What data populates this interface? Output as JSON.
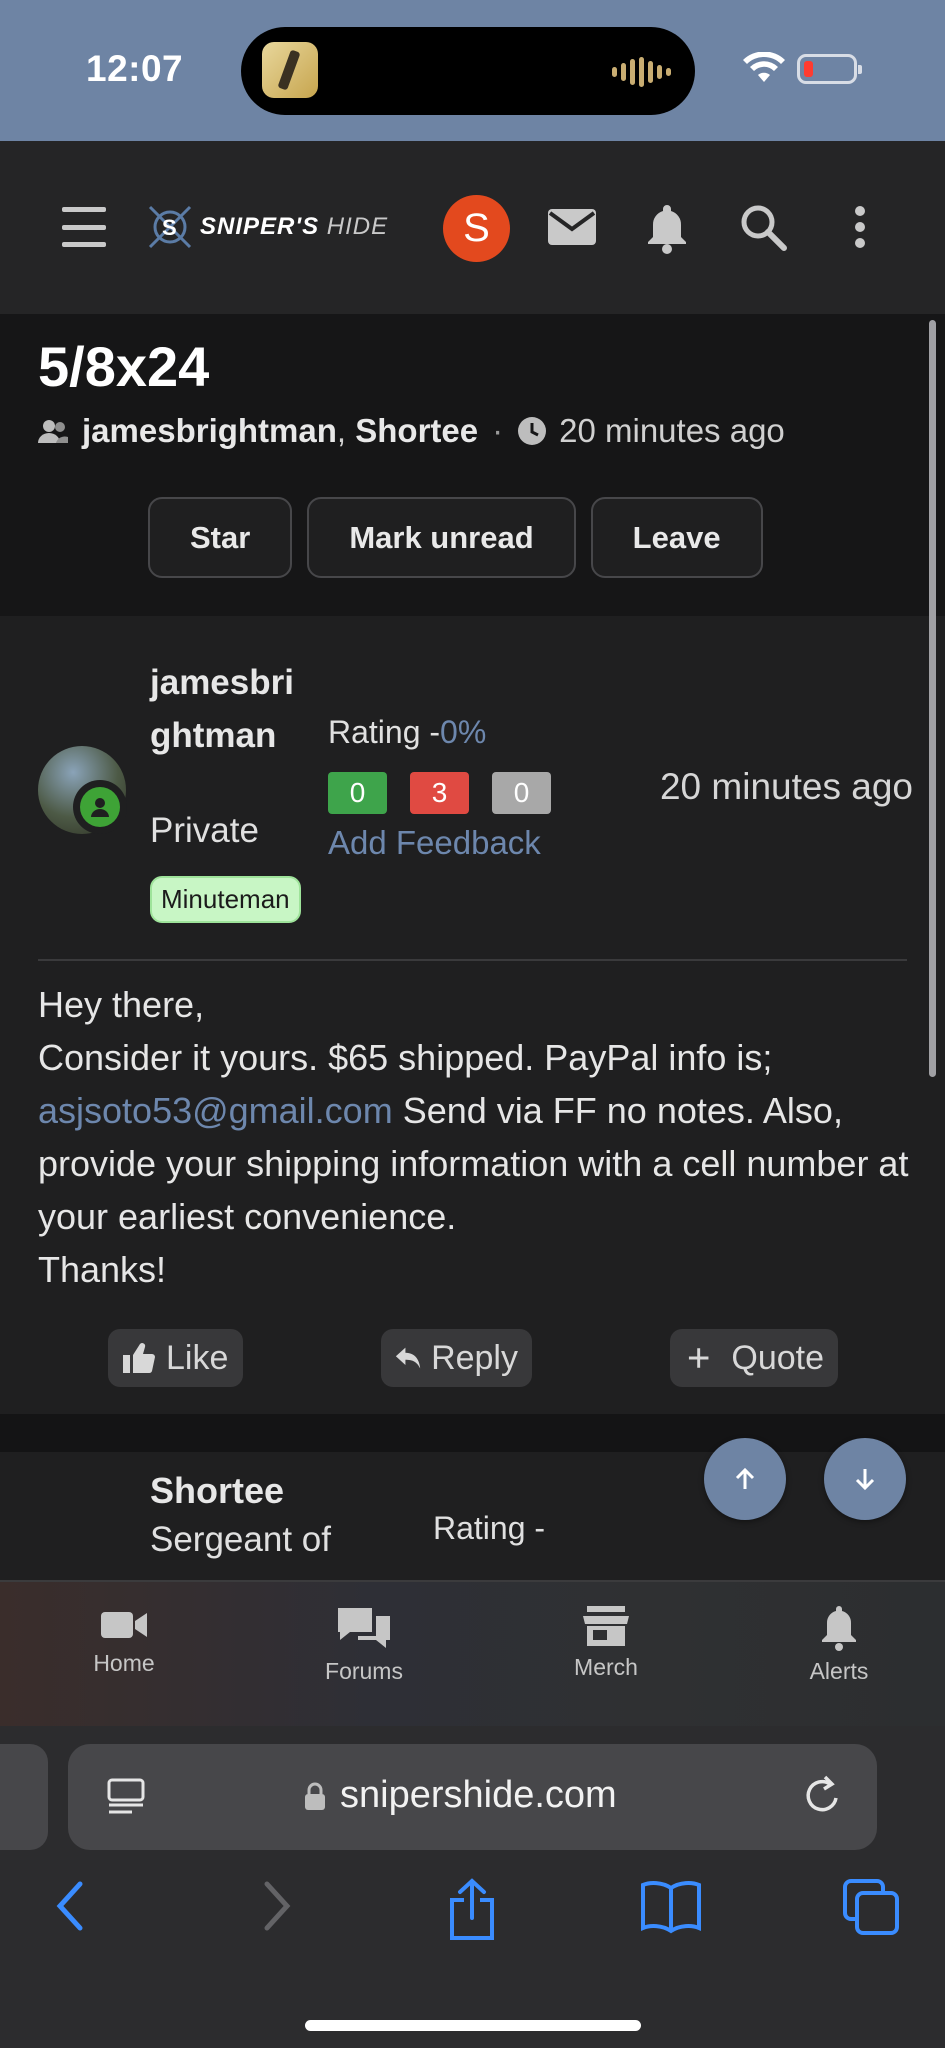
{
  "status_bar": {
    "time": "12:07"
  },
  "header": {
    "logo_brand": "SNIPER'S",
    "logo_hide": "HIDE",
    "avatar_letter": "S"
  },
  "thread": {
    "title": "5/8x24",
    "participants": [
      "jamesbrightman",
      "Shortee"
    ],
    "participant_separator": ",",
    "meta_separator": "·",
    "time": "20 minutes ago",
    "actions": {
      "star": "Star",
      "mark_unread": "Mark unread",
      "leave": "Leave"
    }
  },
  "post": {
    "username": "jamesbrightman",
    "user_title": "Private",
    "badge": "Minuteman",
    "rating_label": "Rating -",
    "rating_value": "0%",
    "feedback": {
      "positive": "0",
      "negative": "3",
      "neutral": "0"
    },
    "add_feedback": "Add Feedback",
    "time": "20 minutes ago",
    "body": {
      "line1": "Hey there,",
      "line2": "Consider it yours. $65 shipped. PayPal info is;",
      "email": "asjsoto53@gmail.com",
      "line3_rest": " Send via FF no notes. Also, provide your shipping information with a cell number at your earliest convenience.",
      "line4": "Thanks!"
    },
    "actions": {
      "like": "Like",
      "reply": "Reply",
      "quote": "Quote"
    }
  },
  "post2": {
    "username": "Shortee",
    "user_title": "Sergeant of",
    "rating_label": "Rating -"
  },
  "tabbar": {
    "home": "Home",
    "forums": "Forums",
    "merch": "Merch",
    "alerts": "Alerts"
  },
  "safari": {
    "url": "snipershide.com"
  },
  "colors": {
    "accent": "#6e84a4",
    "avatar": "#e3491e",
    "link": "#6d87ad",
    "positive": "#3ea44b",
    "negative": "#e04a42",
    "neutral": "#a8a8a8",
    "badge_bg": "#c8f6c5"
  }
}
